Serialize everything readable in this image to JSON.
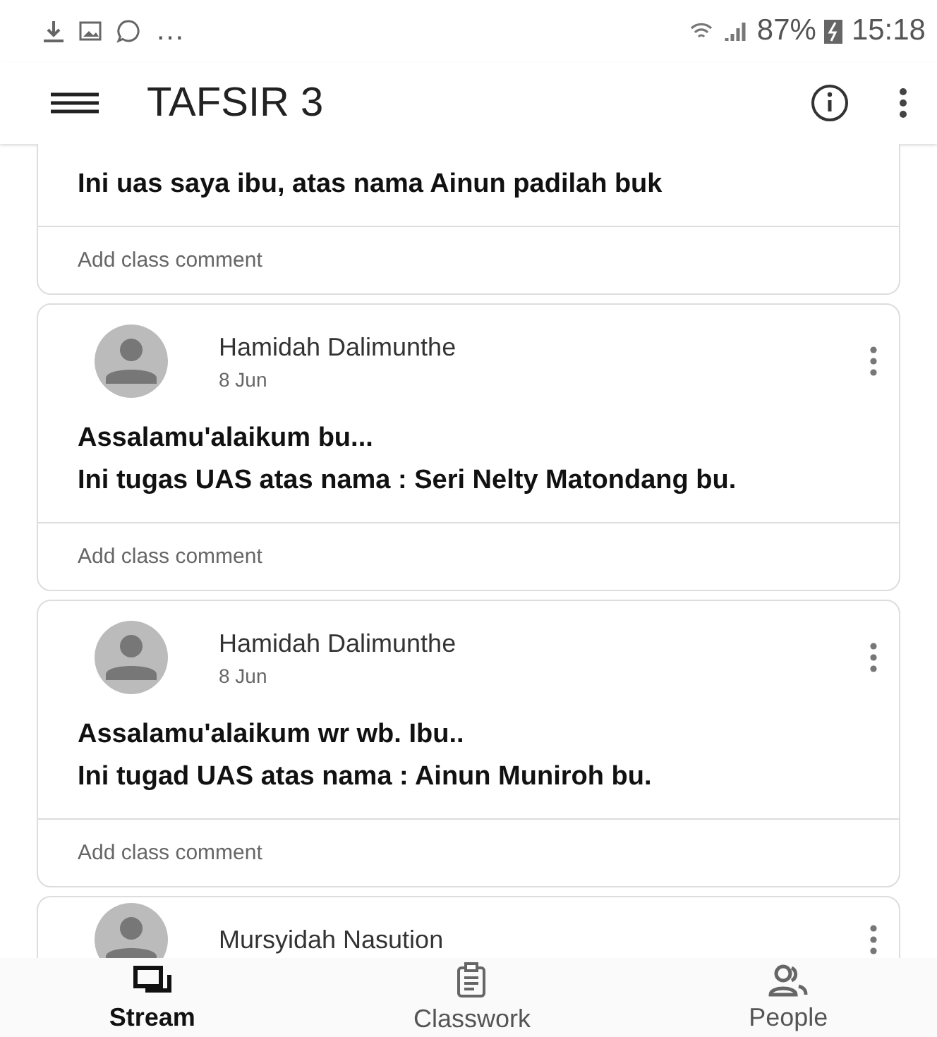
{
  "status_bar": {
    "notifications": "…",
    "battery": "87%",
    "time": "15:18"
  },
  "app_bar": {
    "title": "TAFSIR 3"
  },
  "posts": [
    {
      "kind": "partial",
      "lines": [
        "Ini uas saya ibu, atas nama Ainun padilah buk"
      ],
      "comment": "Add class comment"
    },
    {
      "kind": "full",
      "author": "Hamidah Dalimunthe",
      "date": "8 Jun",
      "lines": [
        "Assalamu'alaikum bu...",
        "Ini tugas UAS atas nama : Seri Nelty Matondang bu."
      ],
      "comment": "Add class comment"
    },
    {
      "kind": "full",
      "author": "Hamidah Dalimunthe",
      "date": "8 Jun",
      "lines": [
        "Assalamu'alaikum wr wb. Ibu..",
        "Ini tugad UAS atas nama : Ainun Muniroh bu."
      ],
      "comment": "Add class comment"
    },
    {
      "kind": "header",
      "author": "Mursyidah Nasution"
    }
  ],
  "bottom_nav": [
    {
      "label": "Stream",
      "selected": true
    },
    {
      "label": "Classwork",
      "selected": false
    },
    {
      "label": "People",
      "selected": false
    }
  ]
}
